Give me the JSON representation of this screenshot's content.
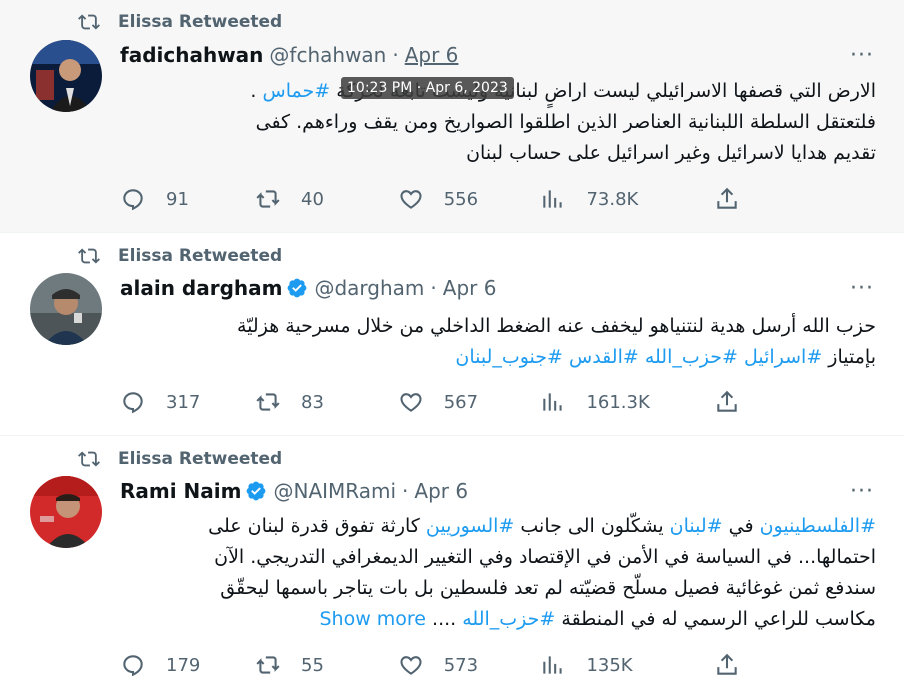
{
  "tooltip": "10:23 PM · Apr 6, 2023",
  "tweets": [
    {
      "retweeted_by": "Elissa Retweeted",
      "name": "fadichahwan",
      "handle": "@fchahwan",
      "dot": "·",
      "date": "Apr 6",
      "more": "···",
      "line1_pre": "الارض التي قصفها الاسرائيلي ليست اراضٍ لبنانية وليست تابعة لحركة ",
      "line1_tag": "#حماس",
      "line1_post": " .",
      "line2": "فلتعتقل السلطة اللبنانية العناصر الذين اطلقوا الصواريخ ومن يقف وراءهم. كفى",
      "line3": "تقديم هدايا لاسرائيل وغير اسرائيل على حساب لبنان",
      "replies": "91",
      "retweets": "40",
      "likes": "556",
      "views": "73.8K"
    },
    {
      "retweeted_by": "Elissa Retweeted",
      "name": "alain dargham",
      "handle": "@dargham",
      "dot": "·",
      "date": "Apr 6",
      "more": "···",
      "line1": "حزب الله أرسل هدية لنتنياهو ليخفف عنه الضغط الداخلي من خلال مسرحية هزليّة",
      "line2_pre": "بإمتياز ",
      "tags": [
        "#اسرائيل",
        "#حزب_الله",
        "#القدس",
        "#جنوب_لبنان"
      ],
      "replies": "317",
      "retweets": "83",
      "likes": "567",
      "views": "161.3K"
    },
    {
      "retweeted_by": "Elissa Retweeted",
      "name": "Rami Naim",
      "handle": "@NAIMRami",
      "dot": "·",
      "date": "Apr 6",
      "more": "···",
      "l1_tag1": "#الفلسطينيون",
      "l1_t1": " في ",
      "l1_tag2": "#لبنان",
      "l1_t2": " يشكّلون الى جانب ",
      "l1_tag3": "#السوريين",
      "l1_t3": " كارثة تفوق قدرة لبنان على",
      "line2": "احتمالها... في السياسة في الأمن في الإقتصاد وفي التغيير الديمغرافي التدريجي. الآن",
      "line3": "سندفع ثمن غوغائية فصيل مسلّح قضيّته لم تعد فلسطين بل بات يتاجر باسمها ليحقّق",
      "line4_pre": "مكاسب للراعي الرسمي له في المنطقة ",
      "line4_tag": "#حزب_الله",
      "line4_post": " ....",
      "show_more": "Show more",
      "replies": "179",
      "retweets": "55",
      "likes": "573",
      "views": "135K"
    }
  ],
  "colors": {
    "accent": "#1d9bf0",
    "muted": "#536471",
    "text": "#0f1419",
    "verified": "#1d9bf0"
  }
}
